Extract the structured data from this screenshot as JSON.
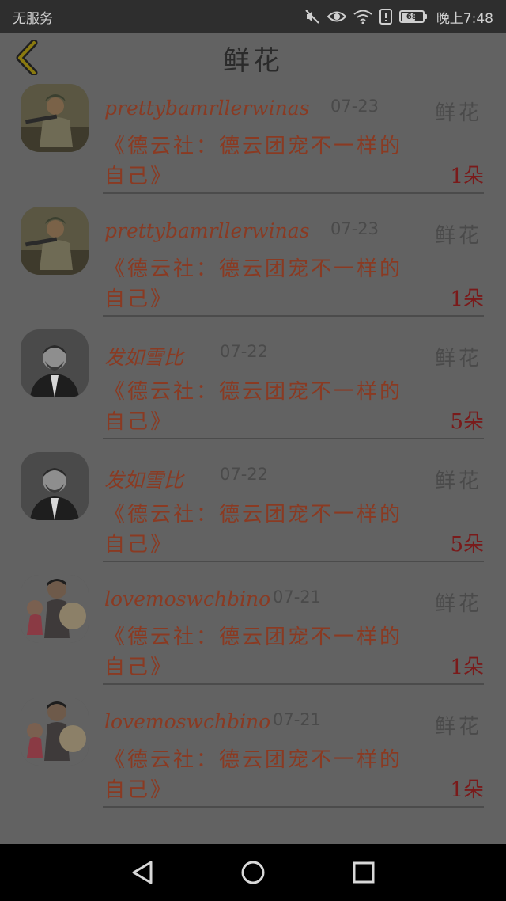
{
  "status_bar": {
    "carrier": "无服务",
    "battery": "68",
    "time": "晚上7:48"
  },
  "header": {
    "title": "鲜花",
    "back_icon": "chevron-left-icon"
  },
  "items": [
    {
      "name": "prettybamrllerwinas",
      "date": "07-23",
      "category": "鲜花",
      "content": "《德云社：德云团宠不一样的自己》",
      "count": "1朵",
      "avatar": "soldier"
    },
    {
      "name": "prettybamrllerwinas",
      "date": "07-23",
      "category": "鲜花",
      "content": "《德云社：德云团宠不一样的自己》",
      "count": "1朵",
      "avatar": "soldier"
    },
    {
      "name": "发如雪比",
      "date": "07-22",
      "category": "鲜花",
      "content": "《德云社：德云团宠不一样的自己》",
      "count": "5朵",
      "avatar": "man-portrait"
    },
    {
      "name": "发如雪比",
      "date": "07-22",
      "category": "鲜花",
      "content": "《德云社：德云团宠不一样的自己》",
      "count": "5朵",
      "avatar": "man-portrait"
    },
    {
      "name": "lovemoswchbino",
      "date": "07-21",
      "category": "鲜花",
      "content": "《德云社：德云团宠不一样的自己》",
      "count": "1朵",
      "avatar": "cartoon-kids"
    },
    {
      "name": "lovemoswchbino",
      "date": "07-21",
      "category": "鲜花",
      "content": "《德云社：德云团宠不一样的自己》",
      "count": "1朵",
      "avatar": "cartoon-kids"
    }
  ],
  "nav_bar": {
    "back": "triangle-back-icon",
    "home": "circle-home-icon",
    "recents": "square-recents-icon"
  }
}
